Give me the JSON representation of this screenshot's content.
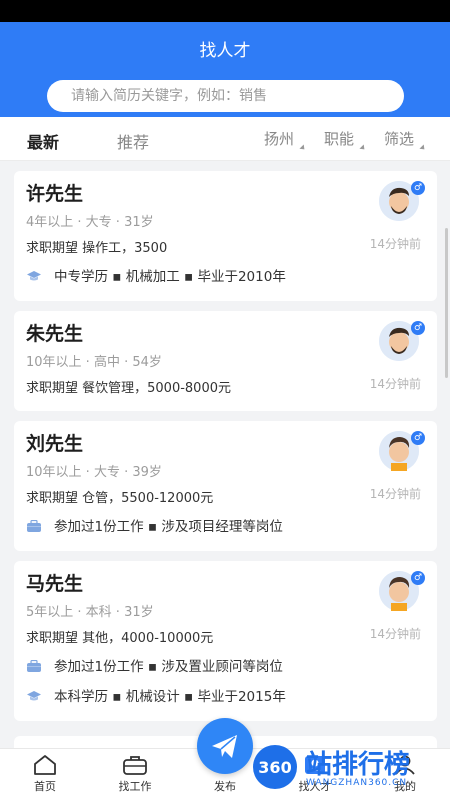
{
  "header": {
    "title": "找人才"
  },
  "search": {
    "placeholder": "请输入简历关键字，例如：销售"
  },
  "tabs": [
    {
      "label": "最新"
    },
    {
      "label": "推荐"
    }
  ],
  "filters": [
    {
      "label": "扬州"
    },
    {
      "label": "职能"
    },
    {
      "label": "筛选"
    }
  ],
  "cards": [
    {
      "name": "许先生",
      "meta": "4年以上 · 大专 · 31岁",
      "expect": "求职期望 操作工，3500",
      "lines": [
        {
          "icon": "education-cap-icon",
          "text": "中专学历 ▪ 机械加工 ▪ 毕业于2010年"
        }
      ],
      "time": "14分钟前",
      "gender": "♂"
    },
    {
      "name": "朱先生",
      "meta": "10年以上 · 高中 · 54岁",
      "expect": "求职期望 餐饮管理，5000-8000元",
      "lines": [],
      "time": "14分钟前",
      "gender": "♂"
    },
    {
      "name": "刘先生",
      "meta": "10年以上 · 大专 · 39岁",
      "expect": "求职期望 仓管，5500-12000元",
      "lines": [
        {
          "icon": "briefcase-icon",
          "text": "参加过1份工作 ▪ 涉及项目经理等岗位"
        }
      ],
      "time": "14分钟前",
      "gender": "♂"
    },
    {
      "name": "马先生",
      "meta": "5年以上 · 本科 · 31岁",
      "expect": "求职期望 其他，4000-10000元",
      "lines": [
        {
          "icon": "briefcase-icon",
          "text": "参加过1份工作 ▪ 涉及置业顾问等岗位"
        },
        {
          "icon": "education-cap-icon",
          "text": "本科学历 ▪ 机械设计 ▪ 毕业于2015年"
        }
      ],
      "time": "14分钟前",
      "gender": "♂"
    }
  ],
  "tabbar": [
    {
      "label": "首页"
    },
    {
      "label": "找工作"
    },
    {
      "label": "发布"
    },
    {
      "label": "找人才"
    },
    {
      "label": "我的"
    }
  ],
  "watermark": {
    "text": "站排行榜",
    "sub": "WANGZHAN360.CN",
    "badge": "360"
  },
  "colors": {
    "primary": "#2f7cf6"
  }
}
